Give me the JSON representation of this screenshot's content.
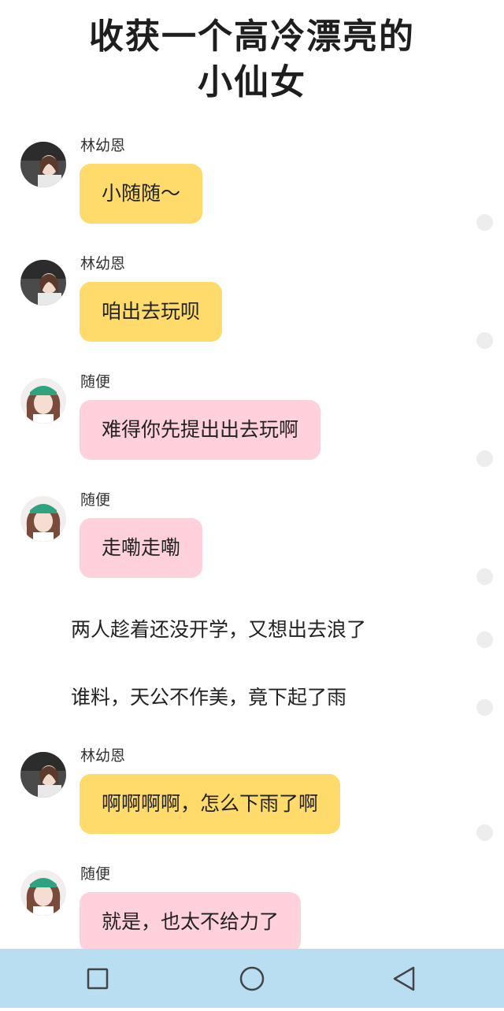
{
  "header": {
    "title_line1": "收获一个高冷漂亮的",
    "title_line2": "小仙女"
  },
  "messages": [
    {
      "sender": "林幼恩",
      "text": "小随随～",
      "style": "yellow"
    },
    {
      "sender": "林幼恩",
      "text": "咱出去玩呗",
      "style": "yellow"
    },
    {
      "sender": "随便",
      "text": "难得你先提出出去玩啊",
      "style": "pink"
    },
    {
      "sender": "随便",
      "text": "走嘞走嘞",
      "style": "pink"
    },
    {
      "sender": "林幼恩",
      "text": "啊啊啊啊，怎么下雨了啊",
      "style": "yellow"
    },
    {
      "sender": "随便",
      "text": "就是，也太不给力了",
      "style": "pink"
    }
  ],
  "narration": [
    "两人趁着还没开学，又想出去浪了",
    "谁料，天公不作美，竟下起了雨"
  ],
  "colors": {
    "yellow_bubble": "#ffdb6b",
    "pink_bubble": "#ffd1dd",
    "nav_bar": "#b9def1"
  },
  "navbar": {
    "icons": [
      "square-recent-apps-icon",
      "circle-home-icon",
      "triangle-back-icon"
    ]
  }
}
